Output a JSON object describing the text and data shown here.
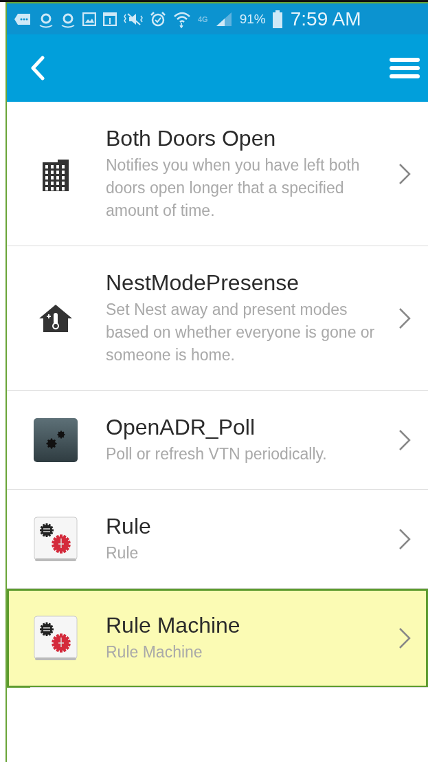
{
  "status_bar": {
    "network": "4G",
    "battery": "91%",
    "time": "7:59 AM"
  },
  "items": [
    {
      "kind": "building",
      "title": "Both Doors Open",
      "description": "Notifies you when you have left both doors open longer that a specified amount of time.",
      "selected": false
    },
    {
      "kind": "thermometer-house",
      "title": "NestModePresense",
      "description": "Set Nest away and present modes based on whether everyone is gone or someone is home.",
      "selected": false
    },
    {
      "kind": "gears-dark",
      "title": "OpenADR_Poll",
      "description": "Poll or refresh VTN periodically.",
      "selected": false
    },
    {
      "kind": "rule",
      "title": "Rule",
      "description": "Rule",
      "selected": false
    },
    {
      "kind": "rule",
      "title": "Rule Machine",
      "description": "Rule Machine",
      "selected": true
    }
  ]
}
